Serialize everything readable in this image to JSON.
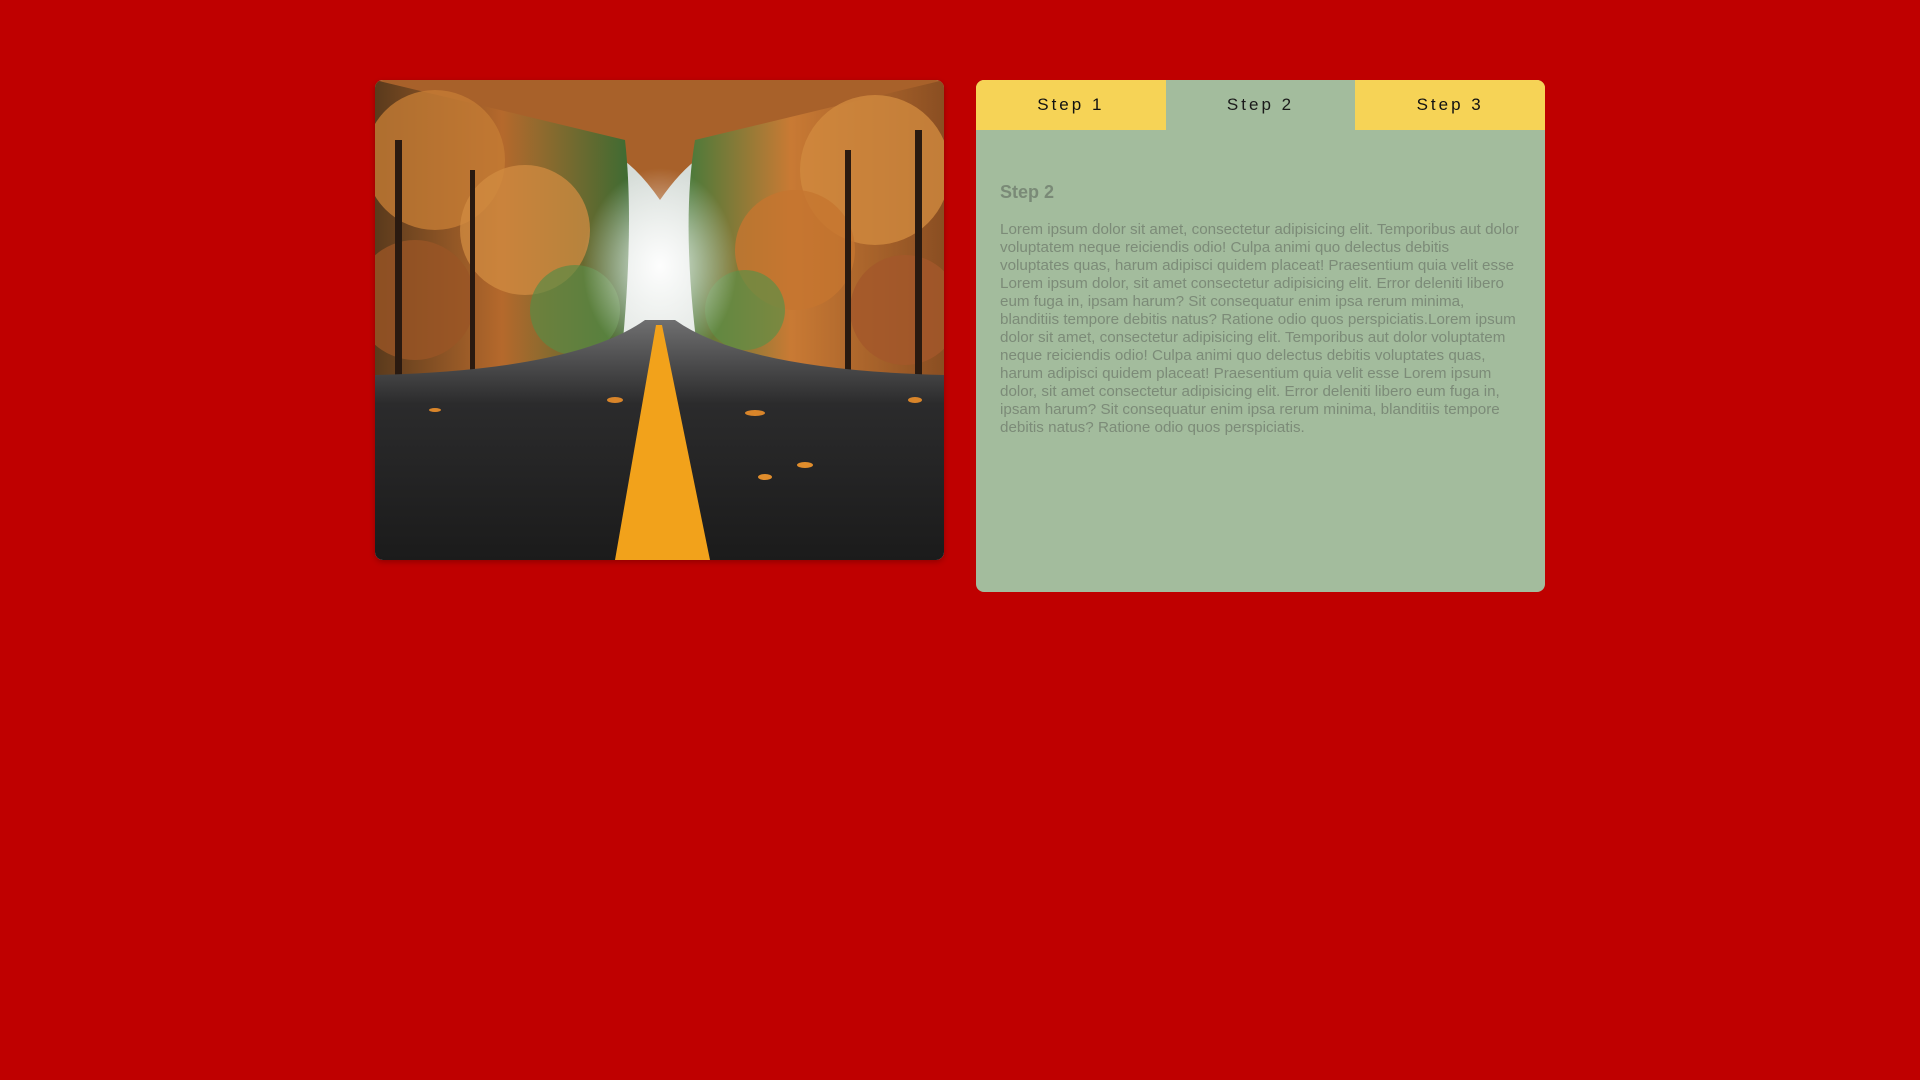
{
  "photo": {
    "icon": "road-autumn-forest-image",
    "description_hidden": ""
  },
  "tabs": [
    {
      "label": "Step 1",
      "active": false
    },
    {
      "label": "Step 2",
      "active": true
    },
    {
      "label": "Step 3",
      "active": false
    }
  ],
  "panel": {
    "title": "Step 2",
    "body": "Lorem ipsum dolor sit amet, consectetur adipisicing elit. Temporibus aut dolor voluptatem neque reiciendis odio! Culpa animi quo delectus debitis voluptates quas, harum adipisci quidem placeat! Praesentium quia velit esse Lorem ipsum dolor, sit amet consectetur adipisicing elit. Error deleniti libero eum fuga in, ipsam harum? Sit consequatur enim ipsa rerum minima, blanditiis tempore debitis natus? Ratione odio quos perspiciatis.Lorem ipsum dolor sit amet, consectetur adipisicing elit. Temporibus aut dolor voluptatem neque reiciendis odio! Culpa animi quo delectus debitis voluptates quas, harum adipisci quidem placeat! Praesentium quia velit esse Lorem ipsum dolor, sit amet consectetur adipisicing elit. Error deleniti libero eum fuga in, ipsam harum? Sit consequatur enim ipsa rerum minima, blanditiis tempore debitis natus? Ratione odio quos perspiciatis."
  },
  "colors": {
    "page_background": "#bf0000",
    "tab_inactive": "#f6d356",
    "tab_active": "#a3bc9d",
    "panel_background": "#a3bc9d",
    "panel_text": "#7c8b78"
  }
}
